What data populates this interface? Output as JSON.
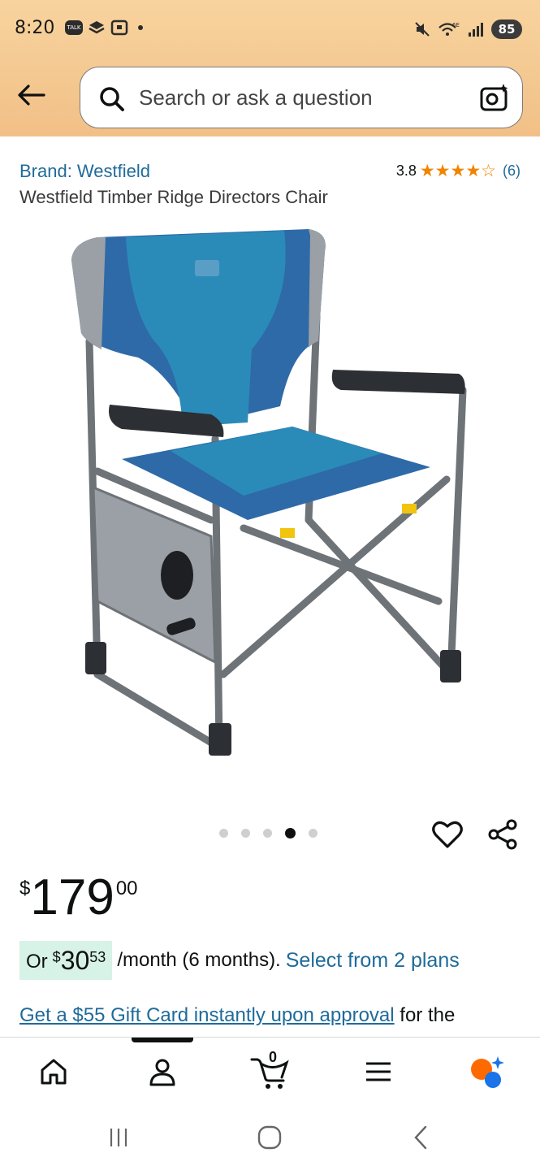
{
  "status_bar": {
    "time": "8:20",
    "battery": "85",
    "chip_talk": "TALK"
  },
  "search": {
    "placeholder": "Search or ask a question"
  },
  "product": {
    "brand": "Brand: Westfield",
    "rating_value": "3.8",
    "rating_count": "(6)",
    "rating_stars": 3.8,
    "title": "Westfield Timber Ridge Directors Chair"
  },
  "carousel": {
    "total": 5,
    "active_index": 4
  },
  "price": {
    "currency": "$",
    "dollars": "179",
    "cents": "00"
  },
  "monthly": {
    "or": "Or",
    "currency": "$",
    "dollars": "30",
    "cents": "53",
    "per": "/month (6 months).",
    "plans_link": "Select from 2 plans"
  },
  "gift": {
    "link": "Get a $55 Gift Card instantly upon approval",
    "rest": " for the"
  },
  "bottom_nav": {
    "cart_count": "0",
    "items": [
      "home-icon",
      "account-icon",
      "cart-icon",
      "menu-icon",
      "rufus-icon"
    ]
  },
  "colors": {
    "header_bg": "#f3c48a",
    "link": "#1f6b9a",
    "star": "#f08400",
    "monthly_chip": "#d7f2e6"
  }
}
